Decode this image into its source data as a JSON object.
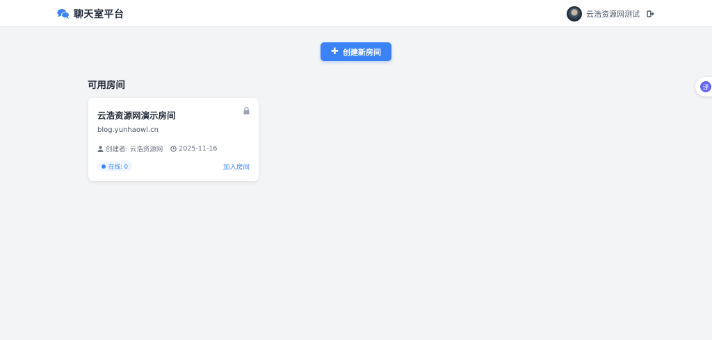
{
  "header": {
    "brand_title": "聊天室平台",
    "brand_icon": "comments-icon",
    "username": "云浩资源网测试",
    "logout_icon": "sign-out-icon"
  },
  "actions": {
    "create_room_label": "创建新房间",
    "create_room_icon": "plus-icon"
  },
  "rooms_section": {
    "title": "可用房间",
    "rooms": [
      {
        "name": "云浩资源网演示房间",
        "description": "blog.yunhaowl.cn",
        "creator_label": "创建者: 云浩资源网",
        "created_date": "2025-11-16",
        "online_label": "在线: 0",
        "join_label": "加入房间",
        "locked": true
      }
    ]
  },
  "translate_widget": {
    "label": "译"
  },
  "colors": {
    "primary": "#3b82f6",
    "background": "#f3f4f6",
    "card": "#ffffff",
    "text": "#1f2937",
    "muted": "#6b7280",
    "translate": "#6366f1"
  }
}
